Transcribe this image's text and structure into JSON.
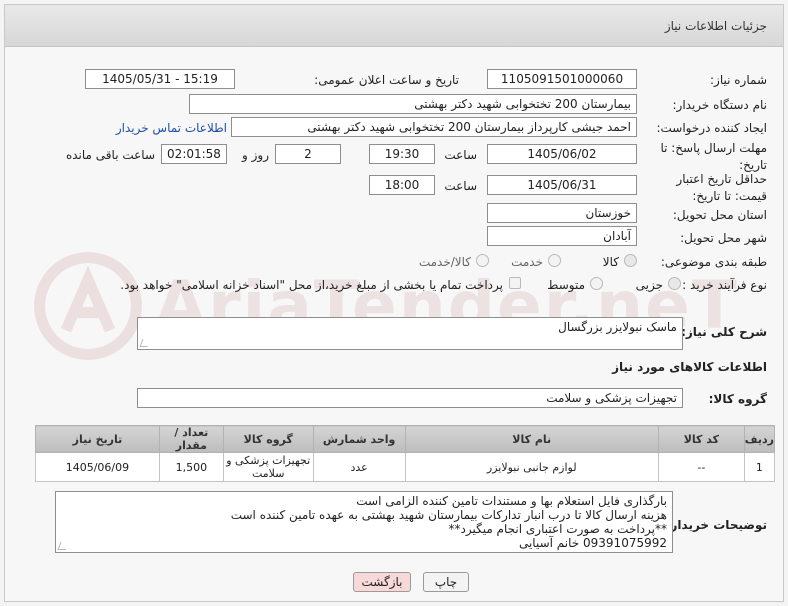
{
  "header": {
    "title": "جزئیات اطلاعات نیاز"
  },
  "fields": {
    "need_number_label": "شماره نیاز:",
    "need_number": "1105091501000060",
    "announce_label": "تاریخ و ساعت اعلان عمومی:",
    "announce_value": "1405/05/31 - 15:19",
    "buyer_org_label": "نام دستگاه خریدار:",
    "buyer_org": "بیمارستان 200 تختخوابی شهید دکتر بهشتی",
    "creator_label": "ایجاد کننده درخواست:",
    "creator": "احمد جیشی کارپرداز بیمارستان 200 تختخوابی شهید دکتر بهشتی",
    "contact_link": "اطلاعات تماس خریدار",
    "reply_deadline_label": "مهلت ارسال پاسخ: تا تاریخ:",
    "reply_date": "1405/06/02",
    "time_label": "ساعت",
    "reply_time": "19:30",
    "days": "2",
    "day_and_label": "روز و",
    "remaining": "02:01:58",
    "remaining_label": "ساعت باقی مانده",
    "min_price_label": "حداقل تاریخ اعتبار قیمت: تا تاریخ:",
    "price_date": "1405/06/31",
    "price_time": "18:00",
    "province_label": "استان محل تحویل:",
    "province": "خوزستان",
    "city_label": "شهر محل تحویل:",
    "city": "آبادان",
    "category_label": "طبقه بندی موضوعی:",
    "category_options": [
      "کالا",
      "خدمت",
      "کالا/خدمت"
    ],
    "process_label": "نوع فرآیند خرید :",
    "process_options": [
      "جزیی",
      "متوسط"
    ],
    "payment_note": "پرداخت تمام یا بخشی از مبلغ خرید،از محل \"اسناد خزانه اسلامی\" خواهد بود."
  },
  "description": {
    "label": "شرح کلی نیاز:",
    "value": "ماسک نبولایزر بزرگسال"
  },
  "goods_section": {
    "title": "اطلاعات کالاهای مورد نیاز",
    "group_label": "گروه کالا:",
    "group_value": "تجهیزات پزشکی و سلامت"
  },
  "table": {
    "headers": [
      "ردیف",
      "کد کالا",
      "نام کالا",
      "واحد شمارش",
      "گروه کالا",
      "تعداد / مقدار",
      "تاریخ نیاز"
    ],
    "rows": [
      [
        "1",
        "--",
        "لوازم جانبی نبولایزر",
        "عدد",
        "تجهیزات پزشکی و سلامت",
        "1,500",
        "1405/06/09"
      ]
    ]
  },
  "buyer_notes": {
    "label": "توضیحات خریدار:",
    "lines": [
      "بارگذاری فایل استعلام بها و مستندات تامین کننده الزامی است",
      "هزینه ارسال کالا تا درب انبار تدارکات بیمارستان شهید بهشتی به عهده تامین کننده است",
      "**پرداخت به صورت اعتباری انجام میگیرد**",
      "09391075992 خانم آسیایی"
    ]
  },
  "buttons": {
    "print": "چاپ",
    "back": "بازگشت"
  },
  "watermark": {
    "text": "AriaTender.neT"
  },
  "colors": {
    "link": "#1f4fa8",
    "back_button_bg": "#f7d9d9",
    "header_bg": "#dedede"
  }
}
